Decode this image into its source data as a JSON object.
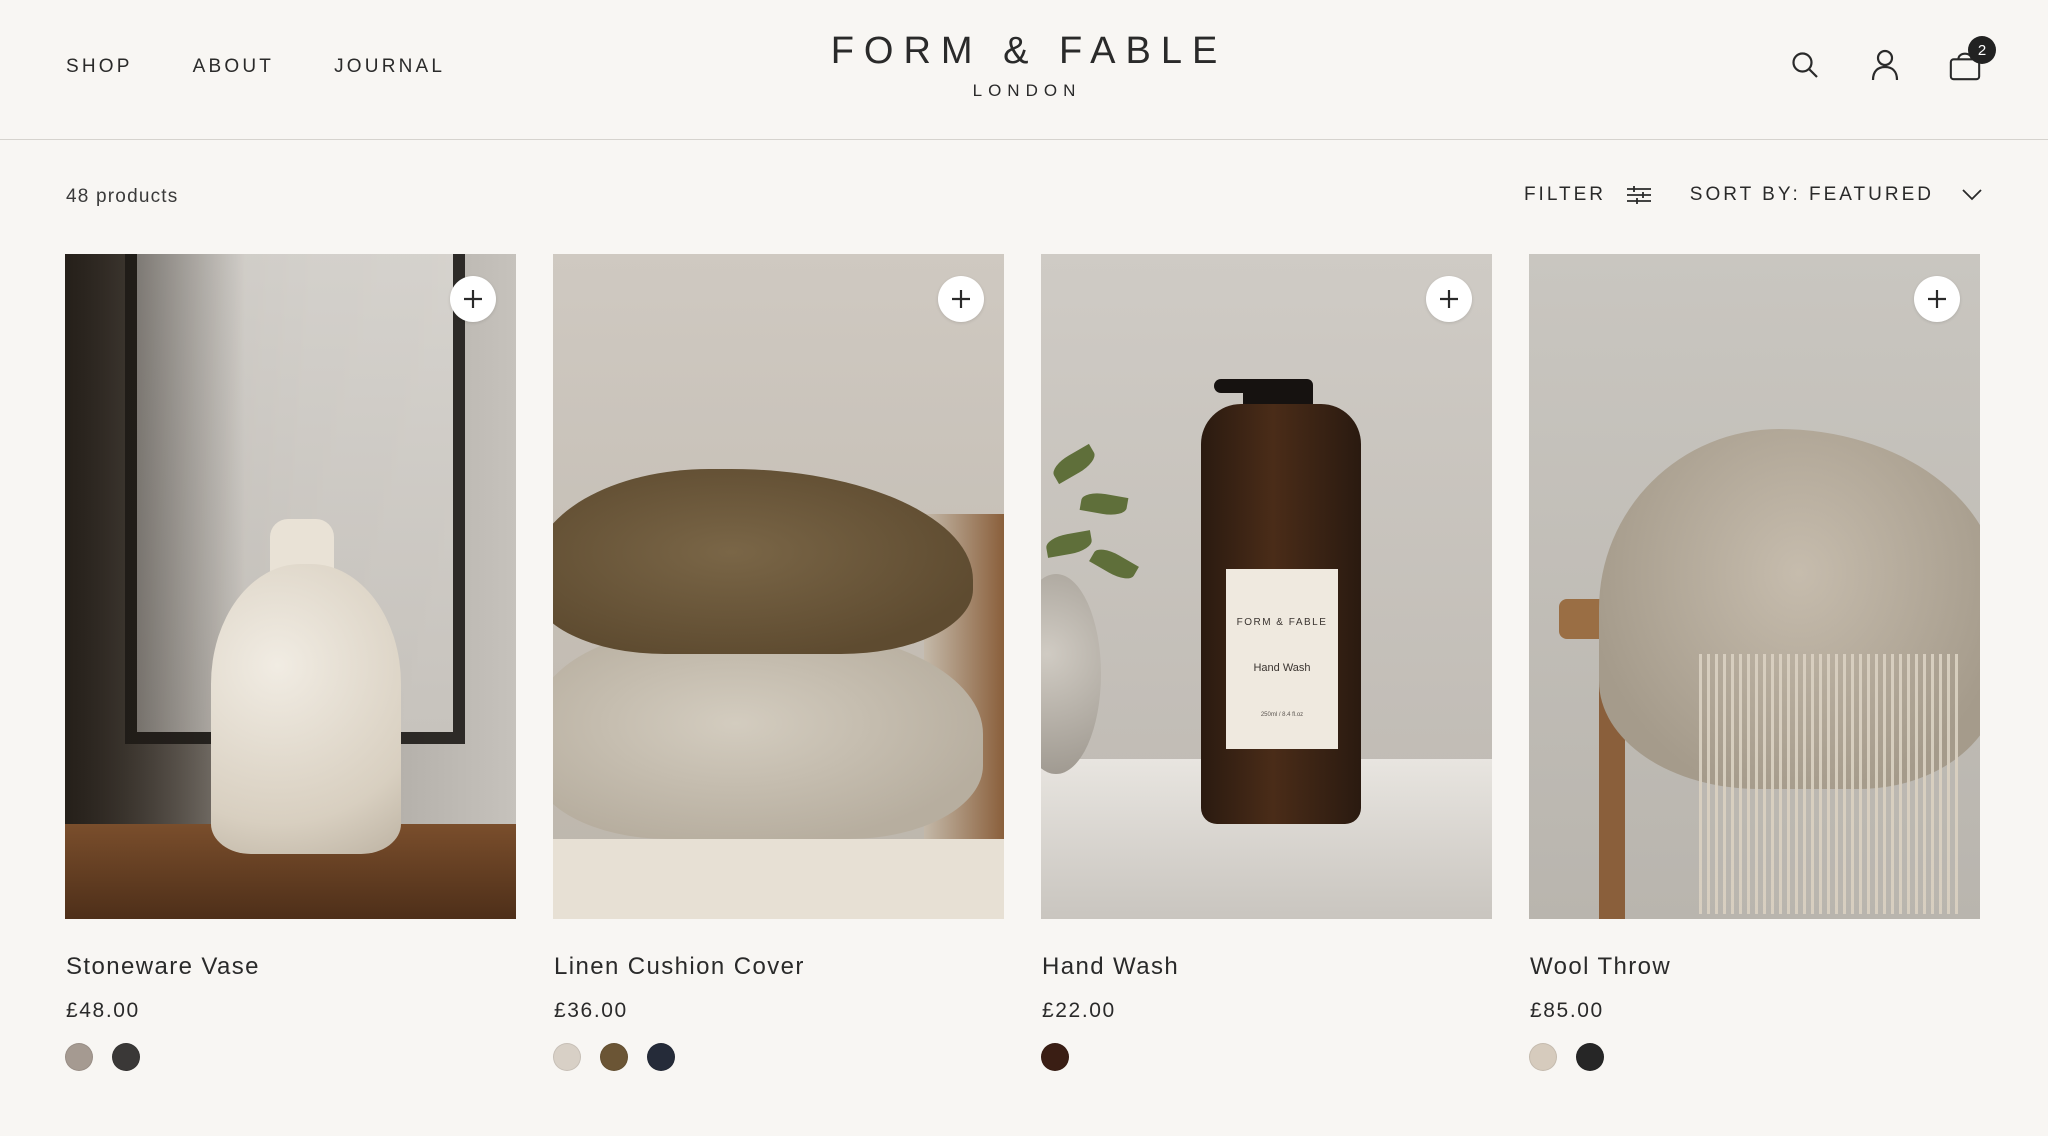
{
  "nav": {
    "items": [
      "SHOP",
      "ABOUT",
      "JOURNAL"
    ]
  },
  "brand": {
    "name": "FORM & FABLE",
    "sub": "LONDON"
  },
  "header": {
    "icons": [
      "search-icon",
      "account-icon",
      "cart-icon"
    ],
    "cart_count": "2"
  },
  "toolbar": {
    "count": "48 products",
    "filter_label": "FILTER",
    "sort_label": "SORT BY: FEATURED"
  },
  "products": [
    {
      "name": "Stoneware Vase",
      "price": "£48.00",
      "swatches": [
        "#a59a91",
        "#3a3837"
      ]
    },
    {
      "name": "Linen Cushion Cover",
      "price": "£36.00",
      "swatches": [
        "#d8d0c6",
        "#6b5535",
        "#252b39"
      ]
    },
    {
      "name": "Hand Wash",
      "price": "£22.00",
      "label_brand": "FORM & FABLE",
      "label_name": "Hand Wash",
      "label_size": "250ml / 8.4 fl.oz",
      "swatches": [
        "#3a1e14"
      ]
    },
    {
      "name": "Wool Throw",
      "price": "£85.00",
      "swatches": [
        "#d6cbbd",
        "#262626"
      ]
    }
  ],
  "colors": {
    "background": "#f8f6f3",
    "text": "#2a2a2a",
    "badge": "#222222"
  }
}
